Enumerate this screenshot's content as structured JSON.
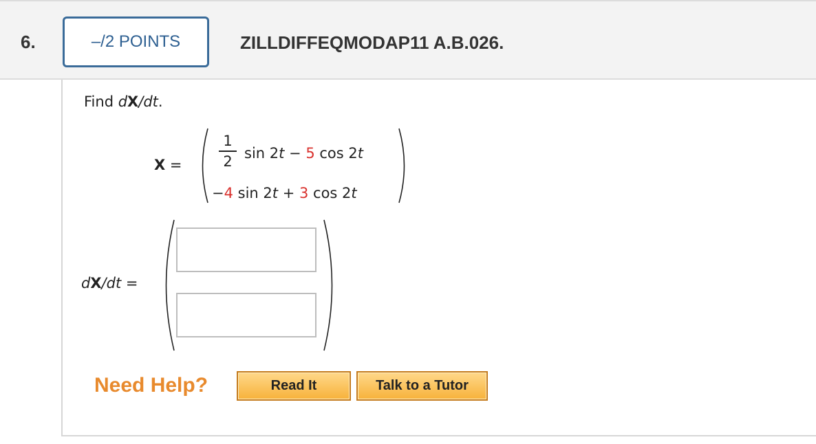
{
  "question": {
    "number": "6.",
    "points": "–/2 POINTS",
    "id": "ZILLDIFFEQMODAP11 A.B.026."
  },
  "prompt": {
    "find": "Find ",
    "d": "d",
    "X": "X",
    "slash_dt": "/dt",
    "period": "."
  },
  "matrix_x": {
    "label": "X",
    "equals": "=",
    "frac_num": "1",
    "frac_den": "2",
    "row1": {
      "sin": "sin 2",
      "t": "t",
      "minus": " − ",
      "coef": "5",
      "cos": " cos 2",
      "t2": "t"
    },
    "row2": {
      "sign": "−",
      "coef1": "4",
      "sin": " sin 2",
      "t": "t",
      "plus": " + ",
      "coef2": "3",
      "cos": " cos 2",
      "t2": "t"
    }
  },
  "answer_label": {
    "d": "d",
    "X": "X",
    "slash_dt": "/dt",
    "equals": "="
  },
  "answers": [
    {
      "value": ""
    },
    {
      "value": ""
    }
  ],
  "help": {
    "need_help": "Need Help?",
    "read_it": "Read It",
    "talk_to_tutor": "Talk to a Tutor"
  },
  "colors": {
    "accent_blue": "#2d5f91",
    "red_number": "#d9302c",
    "help_orange": "#e88a2d",
    "button_orange": "#f7b23b"
  }
}
